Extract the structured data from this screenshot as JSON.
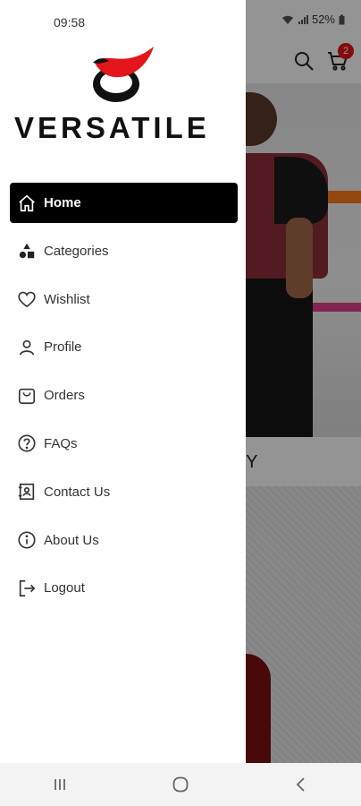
{
  "status_bar": {
    "time": "09:58",
    "battery": "52%"
  },
  "brand": {
    "name": "VERSATILE",
    "accent": "#e3161b"
  },
  "drawer": {
    "items": [
      {
        "label": "Home",
        "icon": "home-icon",
        "active": true
      },
      {
        "label": "Categories",
        "icon": "categories-icon",
        "active": false
      },
      {
        "label": "Wishlist",
        "icon": "heart-icon",
        "active": false
      },
      {
        "label": "Profile",
        "icon": "user-icon",
        "active": false
      },
      {
        "label": "Orders",
        "icon": "bag-icon",
        "active": false
      },
      {
        "label": "FAQs",
        "icon": "question-icon",
        "active": false
      },
      {
        "label": "Contact Us",
        "icon": "contact-icon",
        "active": false
      },
      {
        "label": "About Us",
        "icon": "info-icon",
        "active": false
      },
      {
        "label": "Logout",
        "icon": "logout-icon",
        "active": false
      }
    ]
  },
  "background": {
    "cart_count": "2",
    "section_title_fragment": "RY"
  }
}
